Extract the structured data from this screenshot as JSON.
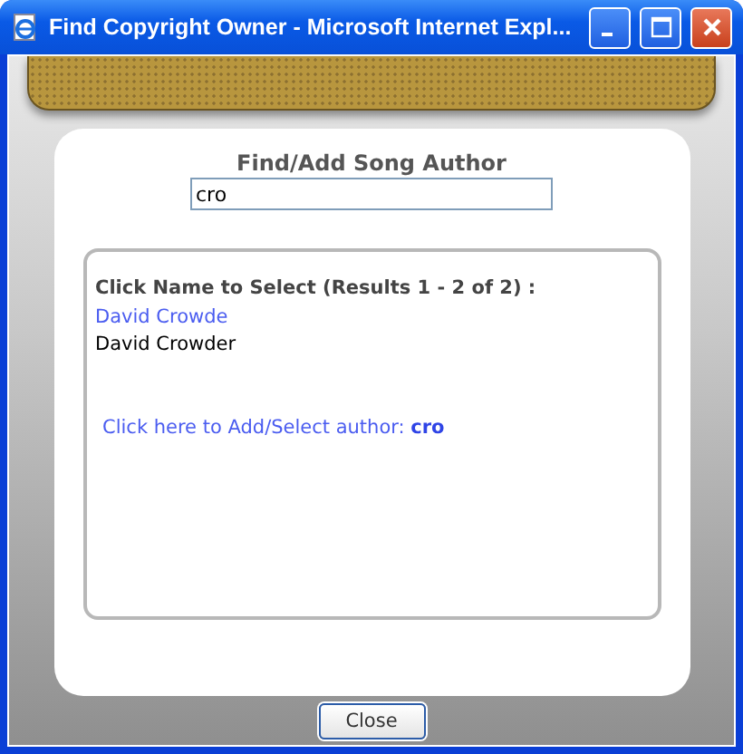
{
  "window": {
    "title": "Find Copyright Owner - Microsoft Internet Expl..."
  },
  "heading": "Find/Add Song Author",
  "search": {
    "value": "cro"
  },
  "results": {
    "caption": "Click Name to Select (Results 1 - 2 of 2) :",
    "items": [
      {
        "name": "David Crowde",
        "highlighted": true
      },
      {
        "name": "David Crowder",
        "highlighted": false
      }
    ],
    "add_link": "Click here to Add/Select author: **cro**"
  },
  "buttons": [
    "Close"
  ]
}
